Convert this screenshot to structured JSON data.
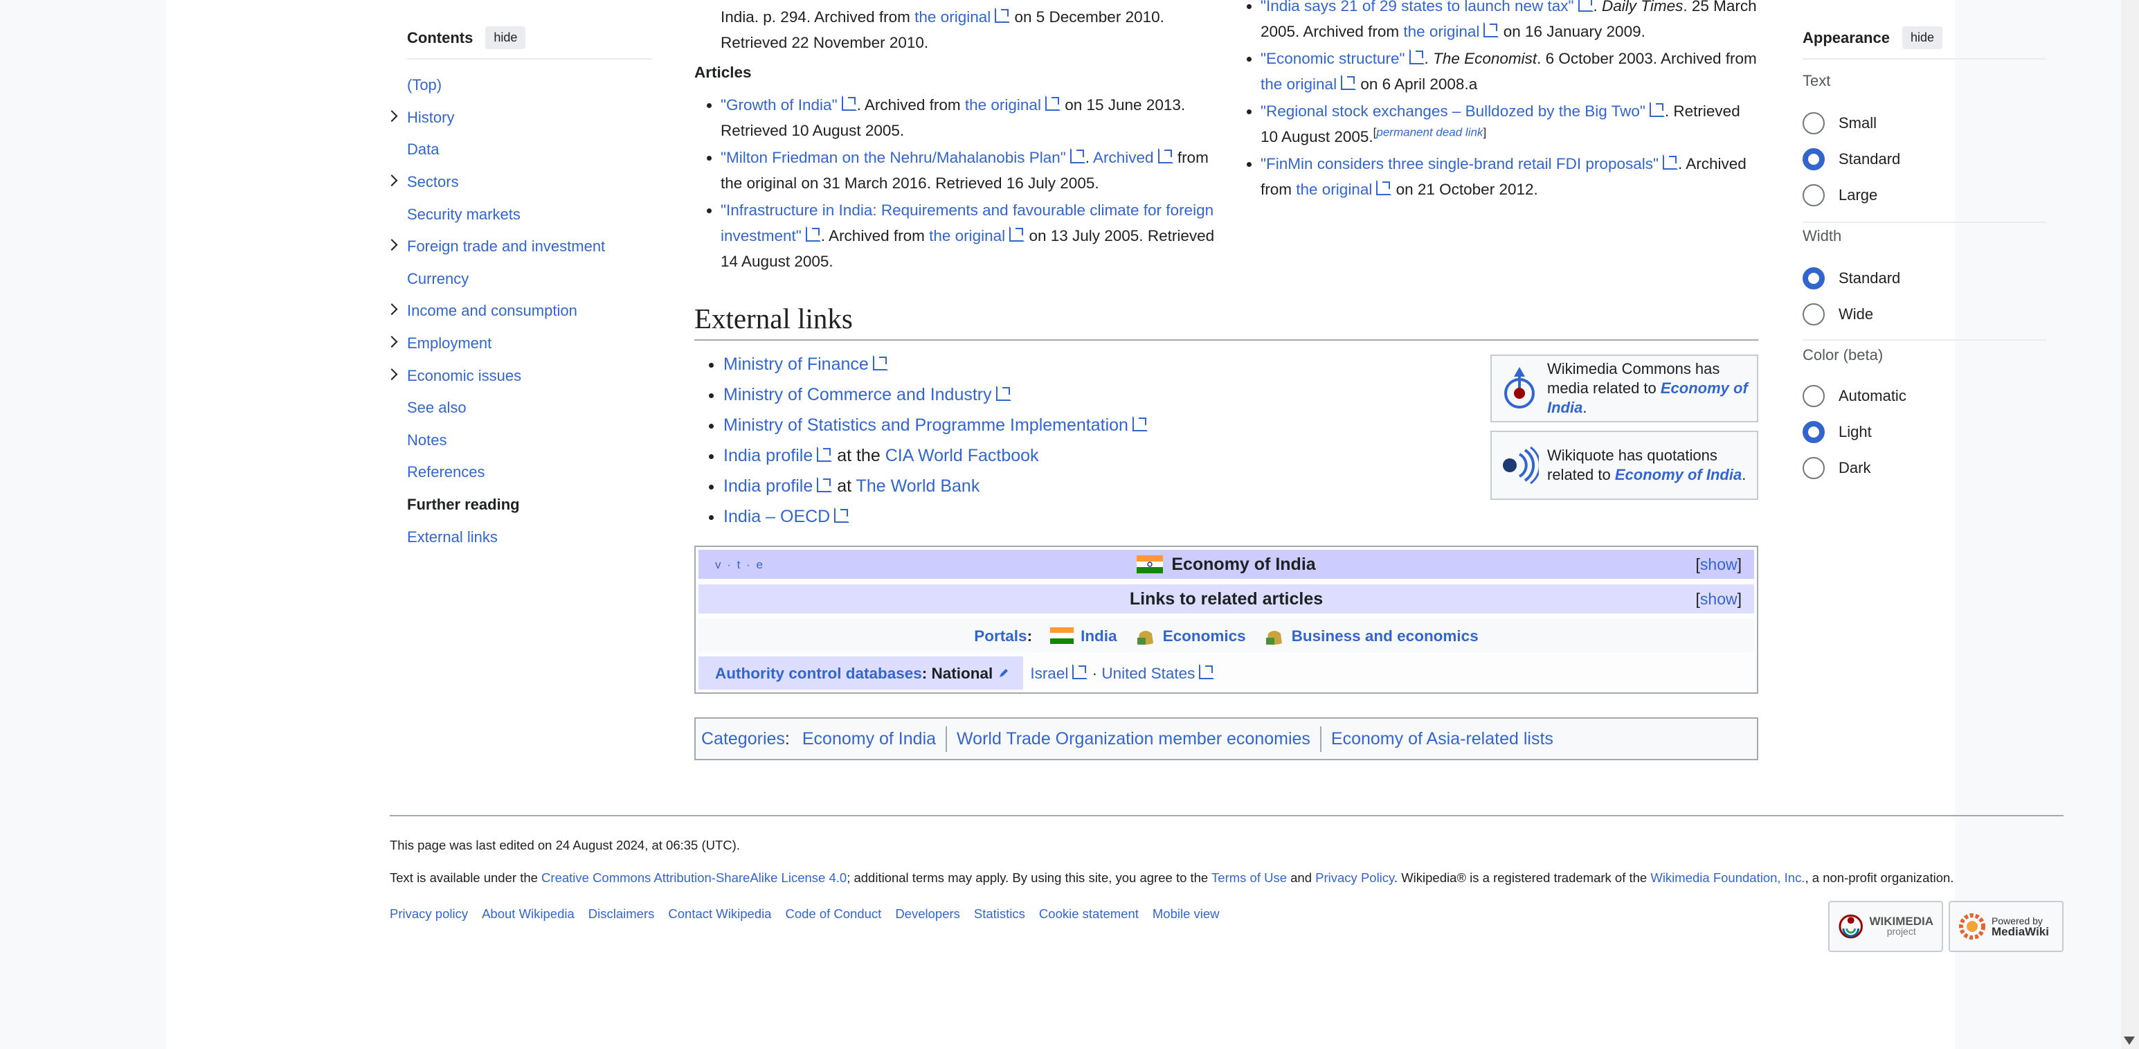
{
  "toc": {
    "title": "Contents",
    "hide_label": "hide",
    "items": [
      {
        "label": "(Top)"
      },
      {
        "label": "History"
      },
      {
        "label": "Data"
      },
      {
        "label": "Sectors"
      },
      {
        "label": "Security markets"
      },
      {
        "label": "Foreign trade and investment"
      },
      {
        "label": "Currency"
      },
      {
        "label": "Income and consumption"
      },
      {
        "label": "Employment"
      },
      {
        "label": "Economic issues"
      },
      {
        "label": "See also"
      },
      {
        "label": "Notes"
      },
      {
        "label": "References"
      },
      {
        "label": "Further reading"
      },
      {
        "label": "External links"
      }
    ]
  },
  "refs_left": {
    "top_line1_a": "India. p. 294. Archived from ",
    "top_line1_link": "the original",
    "top_line1_b": " on 5 December 2010.",
    "top_line2": "Retrieved 22 November 2010.",
    "articles_heading": "Articles",
    "items": [
      {
        "title": "\"Growth of India\"",
        "a": ". Archived from ",
        "orig": "the original",
        "b": " on 15 June 2013. Retrieved 10 August 2005."
      },
      {
        "title": "\"Milton Friedman on the Nehru/Mahalanobis Plan\"",
        "a": ". ",
        "orig": "Archived",
        "b": " from the original on 31 March 2016. Retrieved 16 July 2005."
      },
      {
        "title": "\"Infrastructure in India: Requirements and favourable climate for foreign investment\"",
        "a": ". Archived from ",
        "orig": "the original",
        "b": " on 13 July 2005. Retrieved 14 August 2005."
      }
    ]
  },
  "refs_right": {
    "items": [
      {
        "title": "\"India says 21 of 29 states to launch new tax\"",
        "pub": "Daily Times",
        "a": ". 25 March 2005. Archived from ",
        "orig": "the original",
        "b": " on 16 January 2009."
      },
      {
        "title": "\"Economic structure\"",
        "pub": "The Economist",
        "a": ". 6 October 2003. Archived from ",
        "orig": "the original",
        "b": " on 6 April 2008.a"
      },
      {
        "title": "\"Regional stock exchanges – Bulldozed by the Big Two\"",
        "a": ". Retrieved 10 August 2005.",
        "note": "permanent dead link"
      },
      {
        "title": "\"FinMin considers three single-brand retail FDI proposals\"",
        "a": ". Archived from ",
        "orig": "the original",
        "b": " on 21 October 2012."
      }
    ]
  },
  "external": {
    "heading": "External links",
    "links": {
      "l1": "Ministry of Finance",
      "l2": "Ministry of Commerce and Industry",
      "l3": "Ministry of Statistics and Programme Implementation",
      "l4a": "India profile",
      "l4b": " at the ",
      "l4c": "CIA World Factbook",
      "l5a": "India profile",
      "l5b": " at ",
      "l5c": "The World Bank",
      "l6": "India – OECD"
    },
    "commons": {
      "a": "Wikimedia Commons has media related to ",
      "link": "Economy of India",
      "b": "."
    },
    "quote": {
      "a": "Wikiquote has quotations related to ",
      "link": "Economy of India",
      "b": "."
    }
  },
  "navbox": {
    "vte": "v · t · e",
    "title": "Economy of India",
    "show": "show",
    "group": "Links to related articles",
    "portals_label": "Portals",
    "portals": [
      "India",
      "Economics",
      "Business and economics"
    ],
    "auth_label": "Authority control databases",
    "auth_national": "National",
    "auth_values": [
      "Israel",
      "United States"
    ]
  },
  "categories": {
    "label": "Categories",
    "items": [
      "Economy of India",
      "World Trade Organization member economies",
      "Economy of Asia-related lists"
    ]
  },
  "appearance": {
    "title": "Appearance",
    "hide_label": "hide",
    "text_label": "Text",
    "text_options": [
      "Small",
      "Standard",
      "Large"
    ],
    "width_label": "Width",
    "width_options": [
      "Standard",
      "Wide"
    ],
    "color_label": "Color (beta)",
    "color_options": [
      "Automatic",
      "Light",
      "Dark"
    ],
    "selected": {
      "text": "Standard",
      "width": "Standard",
      "color": "Light"
    }
  },
  "footer": {
    "last_edited": "This page was last edited on 24 August 2024, at 06:35 (UTC).",
    "license_a": "Text is available under the ",
    "license_link": "Creative Commons Attribution-ShareAlike License 4.0",
    "license_b": "; additional terms may apply. By using this site, you agree to the ",
    "terms": "Terms of Use",
    "and": " and ",
    "privacy": "Privacy Policy",
    "license_c": ". Wikipedia® is a registered trademark of the ",
    "foundation": "Wikimedia Foundation, Inc.",
    "license_d": ", a non-profit organization.",
    "links": [
      "Privacy policy",
      "About Wikipedia",
      "Disclaimers",
      "Contact Wikipedia",
      "Code of Conduct",
      "Developers",
      "Statistics",
      "Cookie statement",
      "Mobile view"
    ],
    "wikimedia_badge": {
      "line1": "WIKIMEDIA",
      "line2": "project"
    },
    "mediawiki_badge": {
      "line1": "Powered by",
      "line2": "MediaWiki"
    }
  },
  "colors": {
    "link": "#3366cc",
    "navbox_title": "#ccccff",
    "navbox_group": "#ddddff"
  }
}
